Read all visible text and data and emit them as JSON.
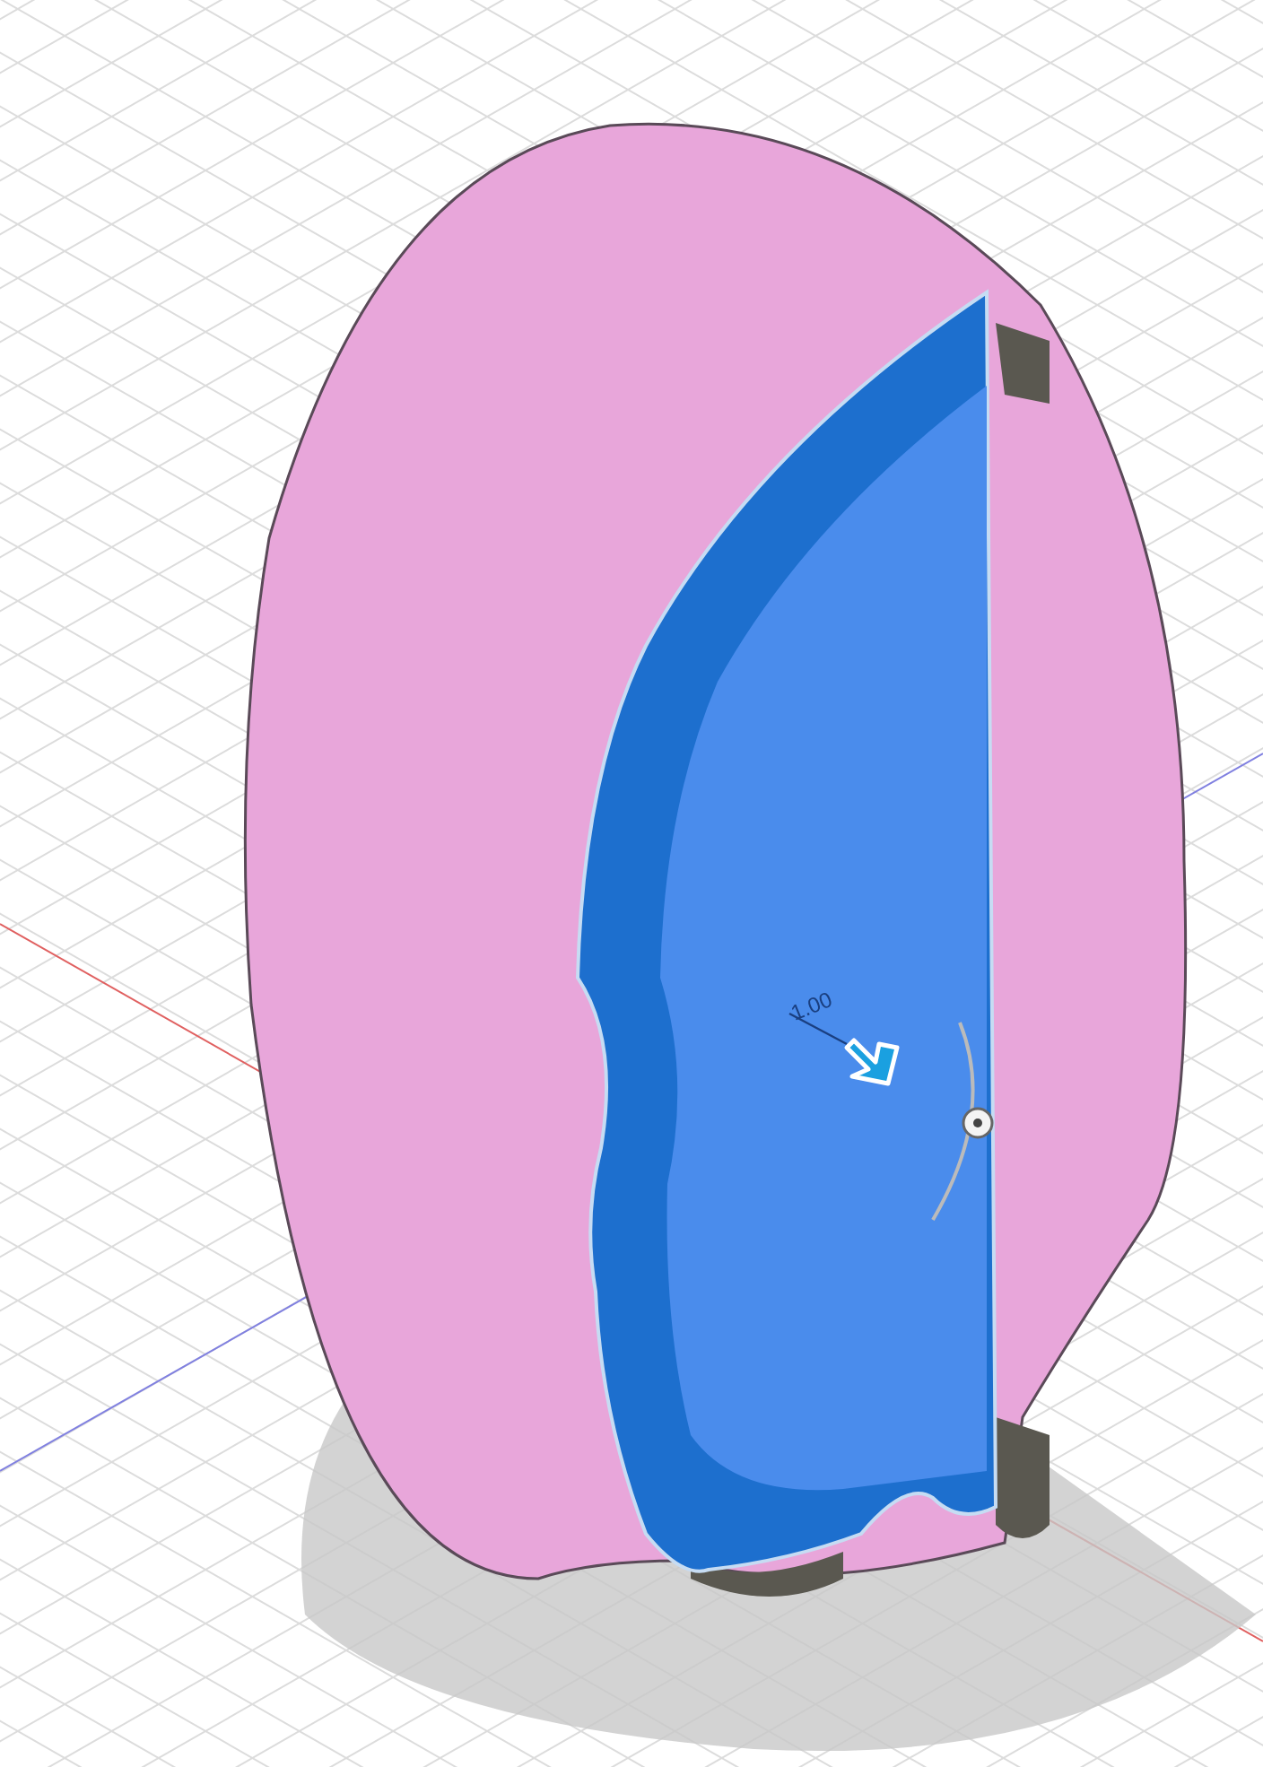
{
  "viewport": {
    "dimension_label": "1.00"
  }
}
